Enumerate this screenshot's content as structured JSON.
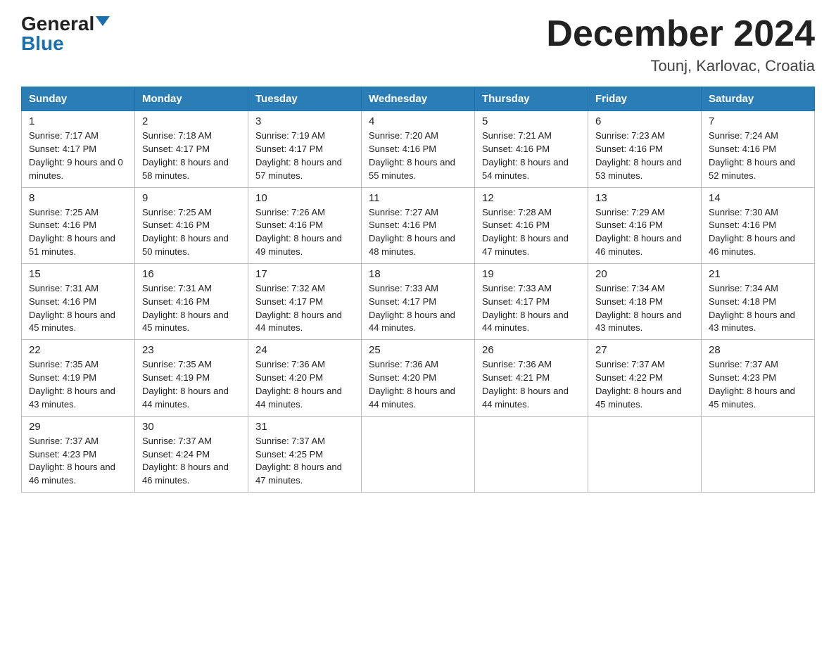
{
  "header": {
    "logo_general": "General",
    "logo_blue": "Blue",
    "month_title": "December 2024",
    "location": "Tounj, Karlovac, Croatia"
  },
  "weekdays": [
    "Sunday",
    "Monday",
    "Tuesday",
    "Wednesday",
    "Thursday",
    "Friday",
    "Saturday"
  ],
  "weeks": [
    [
      {
        "day": "1",
        "sunrise": "7:17 AM",
        "sunset": "4:17 PM",
        "daylight": "9 hours and 0 minutes."
      },
      {
        "day": "2",
        "sunrise": "7:18 AM",
        "sunset": "4:17 PM",
        "daylight": "8 hours and 58 minutes."
      },
      {
        "day": "3",
        "sunrise": "7:19 AM",
        "sunset": "4:17 PM",
        "daylight": "8 hours and 57 minutes."
      },
      {
        "day": "4",
        "sunrise": "7:20 AM",
        "sunset": "4:16 PM",
        "daylight": "8 hours and 55 minutes."
      },
      {
        "day": "5",
        "sunrise": "7:21 AM",
        "sunset": "4:16 PM",
        "daylight": "8 hours and 54 minutes."
      },
      {
        "day": "6",
        "sunrise": "7:23 AM",
        "sunset": "4:16 PM",
        "daylight": "8 hours and 53 minutes."
      },
      {
        "day": "7",
        "sunrise": "7:24 AM",
        "sunset": "4:16 PM",
        "daylight": "8 hours and 52 minutes."
      }
    ],
    [
      {
        "day": "8",
        "sunrise": "7:25 AM",
        "sunset": "4:16 PM",
        "daylight": "8 hours and 51 minutes."
      },
      {
        "day": "9",
        "sunrise": "7:25 AM",
        "sunset": "4:16 PM",
        "daylight": "8 hours and 50 minutes."
      },
      {
        "day": "10",
        "sunrise": "7:26 AM",
        "sunset": "4:16 PM",
        "daylight": "8 hours and 49 minutes."
      },
      {
        "day": "11",
        "sunrise": "7:27 AM",
        "sunset": "4:16 PM",
        "daylight": "8 hours and 48 minutes."
      },
      {
        "day": "12",
        "sunrise": "7:28 AM",
        "sunset": "4:16 PM",
        "daylight": "8 hours and 47 minutes."
      },
      {
        "day": "13",
        "sunrise": "7:29 AM",
        "sunset": "4:16 PM",
        "daylight": "8 hours and 46 minutes."
      },
      {
        "day": "14",
        "sunrise": "7:30 AM",
        "sunset": "4:16 PM",
        "daylight": "8 hours and 46 minutes."
      }
    ],
    [
      {
        "day": "15",
        "sunrise": "7:31 AM",
        "sunset": "4:16 PM",
        "daylight": "8 hours and 45 minutes."
      },
      {
        "day": "16",
        "sunrise": "7:31 AM",
        "sunset": "4:16 PM",
        "daylight": "8 hours and 45 minutes."
      },
      {
        "day": "17",
        "sunrise": "7:32 AM",
        "sunset": "4:17 PM",
        "daylight": "8 hours and 44 minutes."
      },
      {
        "day": "18",
        "sunrise": "7:33 AM",
        "sunset": "4:17 PM",
        "daylight": "8 hours and 44 minutes."
      },
      {
        "day": "19",
        "sunrise": "7:33 AM",
        "sunset": "4:17 PM",
        "daylight": "8 hours and 44 minutes."
      },
      {
        "day": "20",
        "sunrise": "7:34 AM",
        "sunset": "4:18 PM",
        "daylight": "8 hours and 43 minutes."
      },
      {
        "day": "21",
        "sunrise": "7:34 AM",
        "sunset": "4:18 PM",
        "daylight": "8 hours and 43 minutes."
      }
    ],
    [
      {
        "day": "22",
        "sunrise": "7:35 AM",
        "sunset": "4:19 PM",
        "daylight": "8 hours and 43 minutes."
      },
      {
        "day": "23",
        "sunrise": "7:35 AM",
        "sunset": "4:19 PM",
        "daylight": "8 hours and 44 minutes."
      },
      {
        "day": "24",
        "sunrise": "7:36 AM",
        "sunset": "4:20 PM",
        "daylight": "8 hours and 44 minutes."
      },
      {
        "day": "25",
        "sunrise": "7:36 AM",
        "sunset": "4:20 PM",
        "daylight": "8 hours and 44 minutes."
      },
      {
        "day": "26",
        "sunrise": "7:36 AM",
        "sunset": "4:21 PM",
        "daylight": "8 hours and 44 minutes."
      },
      {
        "day": "27",
        "sunrise": "7:37 AM",
        "sunset": "4:22 PM",
        "daylight": "8 hours and 45 minutes."
      },
      {
        "day": "28",
        "sunrise": "7:37 AM",
        "sunset": "4:23 PM",
        "daylight": "8 hours and 45 minutes."
      }
    ],
    [
      {
        "day": "29",
        "sunrise": "7:37 AM",
        "sunset": "4:23 PM",
        "daylight": "8 hours and 46 minutes."
      },
      {
        "day": "30",
        "sunrise": "7:37 AM",
        "sunset": "4:24 PM",
        "daylight": "8 hours and 46 minutes."
      },
      {
        "day": "31",
        "sunrise": "7:37 AM",
        "sunset": "4:25 PM",
        "daylight": "8 hours and 47 minutes."
      },
      null,
      null,
      null,
      null
    ]
  ]
}
